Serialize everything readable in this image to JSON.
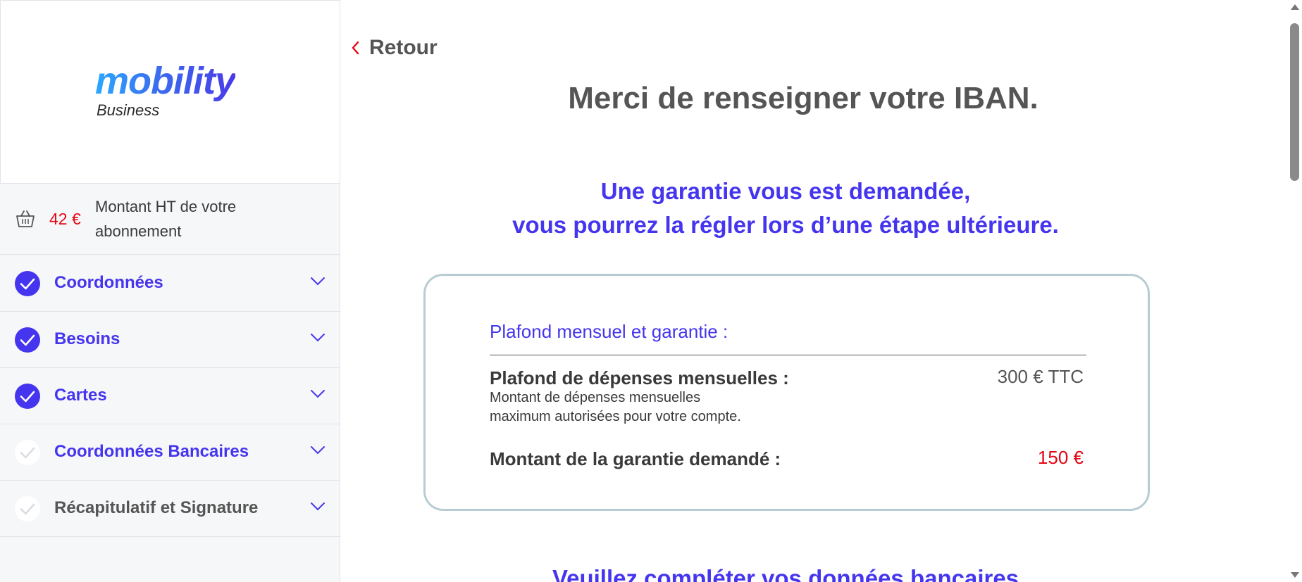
{
  "colors": {
    "accent": "#4535ee",
    "price_red": "#e30613",
    "text_gray": "#555555",
    "card_border": "#b8ccd3"
  },
  "sidebar": {
    "logo": {
      "main": "mobility",
      "sub": "Business"
    },
    "amount": {
      "icon": "basket-icon",
      "value": "42 €",
      "label": "Montant HT de votre abonnement"
    },
    "steps": [
      {
        "label": "Coordonnées",
        "status": "completed",
        "icon": "check-circle-icon"
      },
      {
        "label": "Besoins",
        "status": "completed",
        "icon": "check-circle-icon"
      },
      {
        "label": "Cartes",
        "status": "completed",
        "icon": "check-circle-icon"
      },
      {
        "label": "Coordonnées Bancaires",
        "status": "current",
        "icon": "check-pending-icon"
      },
      {
        "label": "Récapitulatif et Signature",
        "status": "pending",
        "icon": "check-pending-icon"
      }
    ]
  },
  "main": {
    "back_label": "Retour",
    "title": "Merci de renseigner votre IBAN.",
    "guarantee_line1": "Une garantie vous est demandée,",
    "guarantee_line2": "vous pourrez la régler lors d’une étape ultérieure.",
    "card": {
      "header": "Plafond mensuel et garantie :",
      "limit_label": "Plafond de dépenses mensuelles :",
      "limit_desc_line1": "Montant de dépenses mensuelles",
      "limit_desc_line2": "maximum autorisées pour votre compte.",
      "limit_value": "300 € TTC",
      "guarantee_label": "Montant de la garantie demandé :",
      "guarantee_value": "150 €"
    },
    "bank_heading": "Veuillez compléter vos données bancaires"
  }
}
